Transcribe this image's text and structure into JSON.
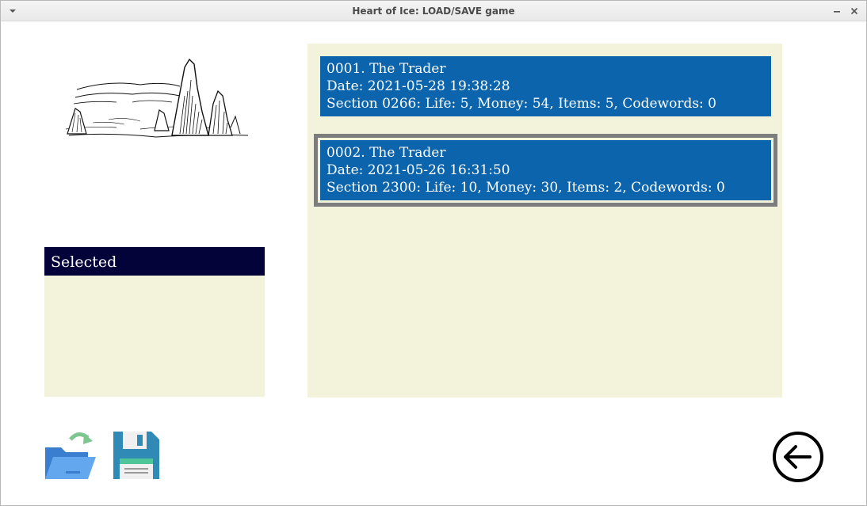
{
  "window": {
    "title": "Heart of Ice: LOAD/SAVE game",
    "menu_icon": "chevron-down-icon",
    "minimize_icon": "minimize-icon",
    "close_icon": "close-icon"
  },
  "illustration": {
    "subject": "rock-spires-landscape"
  },
  "selected_panel": {
    "header": "Selected"
  },
  "saves": [
    {
      "title": "0001. The Trader",
      "date": "Date: 2021-05-28 19:38:28",
      "details": "Section 0266: Life: 5, Money: 54, Items: 5, Codewords: 0",
      "highlighted": false
    },
    {
      "title": "0002. The Trader",
      "date": "Date: 2021-05-26 16:31:50",
      "details": "Section 2300: Life: 10, Money: 30, Items: 2, Codewords: 0",
      "highlighted": true
    }
  ],
  "toolbar": {
    "load_icon": "open-folder-icon",
    "save_icon": "floppy-disk-icon",
    "back_icon": "arrow-left-circle-icon"
  },
  "colors": {
    "panel_bg": "#f3f3dc",
    "item_bg": "#0b64ac",
    "header_bg": "#03033a",
    "highlight_border": "#7d7d7d"
  }
}
